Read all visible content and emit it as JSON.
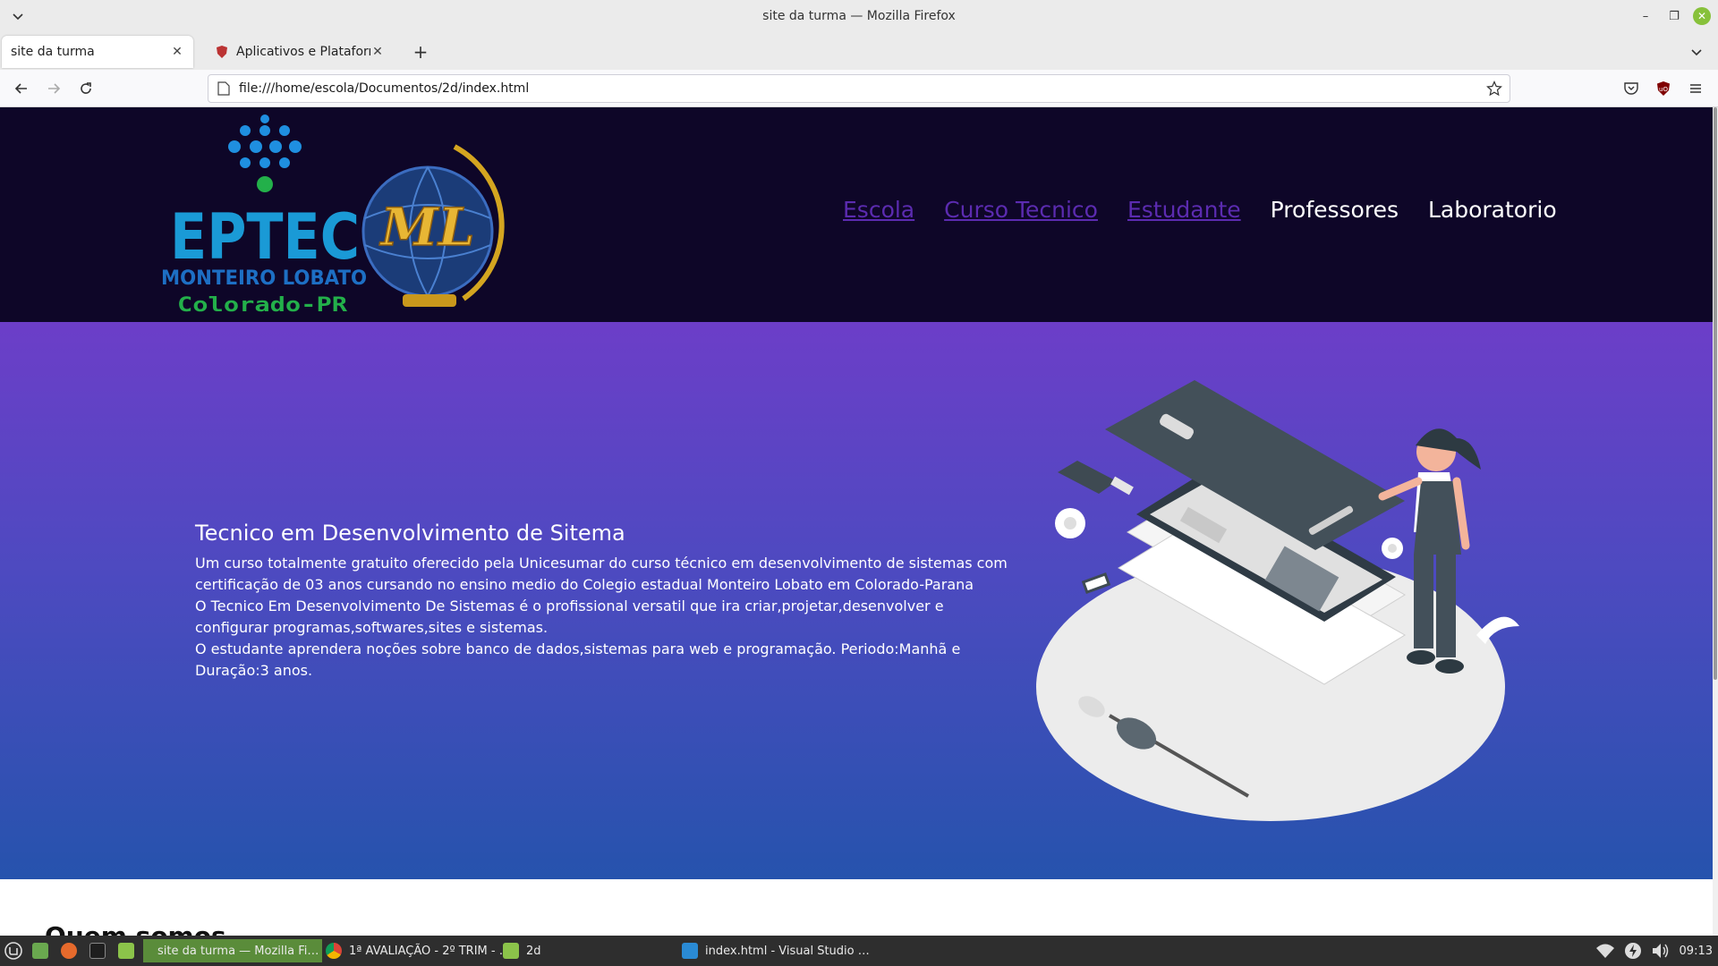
{
  "window": {
    "title": "site da turma — Mozilla Firefox"
  },
  "tabs": [
    {
      "label": "site da turma",
      "active": true
    },
    {
      "label": "Aplicativos e Plataformas E…",
      "active": false
    }
  ],
  "urlbar": {
    "url": "file:///home/escola/Documentos/2d/index.html"
  },
  "site": {
    "logo": {
      "brand": "EPTEC",
      "school": "MONTEIRO LOBATO",
      "city": "Colorado-PR",
      "emblem": "ML"
    },
    "nav": [
      {
        "label": "Escola"
      },
      {
        "label": "Curso Tecnico"
      },
      {
        "label": "Estudante"
      },
      {
        "label": "Professores"
      },
      {
        "label": "Laboratorio"
      }
    ],
    "hero": {
      "title": "Tecnico em Desenvolvimento de Sitema",
      "p1": "Um curso totalmente gratuito oferecido pela Unicesumar do curso técnico em desenvolvimento de sistemas com certificação de 03 anos cursando no ensino medio do Colegio estadual Monteiro Lobato em Colorado-Parana",
      "p2": "O Tecnico Em Desenvolvimento De Sistemas é o profissional versatil que ira criar,projetar,desenvolver e configurar programas,softwares,sites e sistemas.",
      "p3": "O estudante aprendera noções sobre banco de dados,sistemas para web e programação. Periodo:Manhã e Duração:3 anos."
    },
    "next_section_title": "Quem somos"
  },
  "taskbar": {
    "items": [
      {
        "label": "site da turma — Mozilla Fi…",
        "active": true
      },
      {
        "label": "1ª AVALIAÇÃO - 2º TRIM - …"
      },
      {
        "label": "2d"
      },
      {
        "label": "index.html - Visual Studio …"
      }
    ],
    "clock": "09:13"
  },
  "colors": {
    "header_bg": "#0e0628",
    "hero_top": "#6c3ec8",
    "hero_bottom": "#2653ad",
    "visited_link": "#5b2bb0",
    "taskbar_active": "#5a8c3a"
  }
}
